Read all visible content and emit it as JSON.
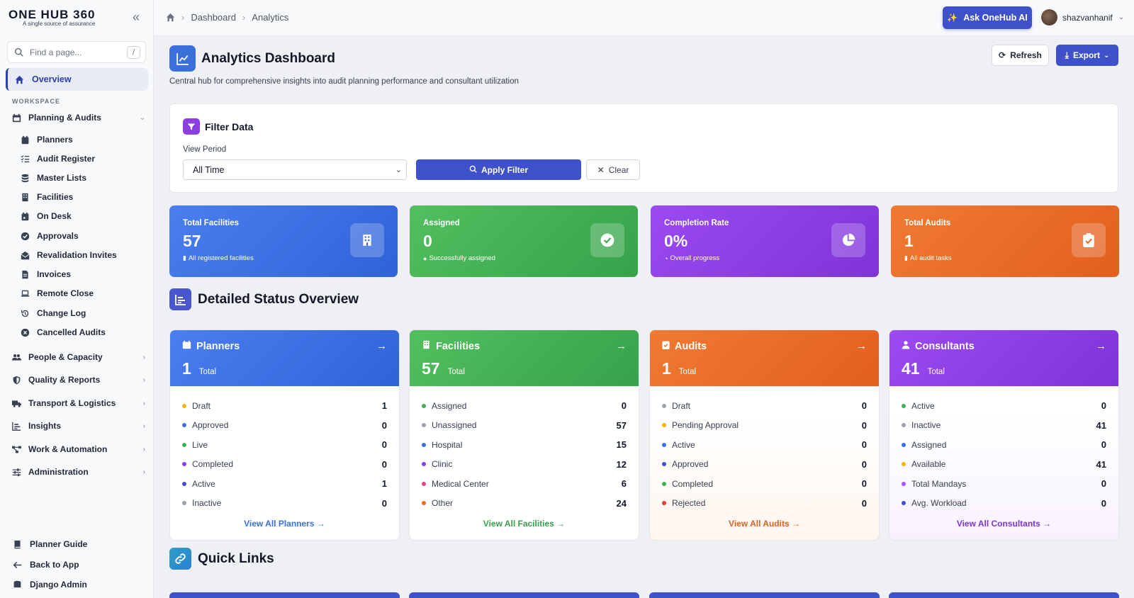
{
  "brand": {
    "name": "ONE HUB 360",
    "tagline": "A single source of assurance"
  },
  "sidebar": {
    "search_placeholder": "Find a page...",
    "search_shortcut": "/",
    "overview": "Overview",
    "workspace_label": "WORKSPACE",
    "planning_group": "Planning & Audits",
    "planning_items": [
      "Planners",
      "Audit Register",
      "Master Lists",
      "Facilities",
      "On Desk",
      "Approvals",
      "Revalidation Invites",
      "Invoices",
      "Remote Close",
      "Change Log",
      "Cancelled Audits"
    ],
    "groups": [
      "People & Capacity",
      "Quality & Reports",
      "Transport & Logistics",
      "Insights",
      "Work & Automation",
      "Administration"
    ],
    "footer": [
      "Planner Guide",
      "Back to App",
      "Django Admin"
    ]
  },
  "topbar": {
    "breadcrumbs": [
      "Dashboard",
      "Analytics"
    ],
    "ai_button": "Ask OneHub AI",
    "username": "shazvanhanif"
  },
  "page": {
    "title": "Analytics Dashboard",
    "subtitle": "Central hub for comprehensive insights into audit planning performance and consultant utilization",
    "refresh": "Refresh",
    "export": "Export"
  },
  "filter": {
    "title": "Filter Data",
    "period_label": "View Period",
    "period_value": "All Time",
    "apply": "Apply Filter",
    "clear": "Clear"
  },
  "stats": [
    {
      "label": "Total Facilities",
      "value": "57",
      "note": "All registered facilities",
      "color": "#3b6fe0"
    },
    {
      "label": "Assigned",
      "value": "0",
      "note": "Successfully assigned",
      "color": "#3fae54"
    },
    {
      "label": "Completion Rate",
      "value": "0%",
      "note": "Overall progress",
      "color": "#8c3ee6"
    },
    {
      "label": "Total Audits",
      "value": "1",
      "note": "All audit tasks",
      "color": "#ea6a26"
    }
  ],
  "status_section": "Detailed Status Overview",
  "cards": [
    {
      "title": "Planners",
      "total": "1",
      "total_word": "Total",
      "link": "View All Planners →",
      "color": "#3b6fe0",
      "rows": [
        {
          "label": "Draft",
          "value": "1",
          "dot": "#f5b400"
        },
        {
          "label": "Approved",
          "value": "0",
          "dot": "#3b6fe0"
        },
        {
          "label": "Live",
          "value": "0",
          "dot": "#3fae54"
        },
        {
          "label": "Completed",
          "value": "0",
          "dot": "#8c3ee6"
        },
        {
          "label": "Active",
          "value": "1",
          "dot": "#3f51c9"
        },
        {
          "label": "Inactive",
          "value": "0",
          "dot": "#9ca3af"
        }
      ]
    },
    {
      "title": "Facilities",
      "total": "57",
      "total_word": "Total",
      "link": "View All Facilities →",
      "color": "#3fae54",
      "rows": [
        {
          "label": "Assigned",
          "value": "0",
          "dot": "#3fae54"
        },
        {
          "label": "Unassigned",
          "value": "57",
          "dot": "#9ca3af"
        },
        {
          "label": "Hospital",
          "value": "15",
          "dot": "#3b6fe0"
        },
        {
          "label": "Clinic",
          "value": "12",
          "dot": "#8c3ee6"
        },
        {
          "label": "Medical Center",
          "value": "6",
          "dot": "#e0488a"
        },
        {
          "label": "Other",
          "value": "24",
          "dot": "#ea6a26"
        }
      ]
    },
    {
      "title": "Audits",
      "total": "1",
      "total_word": "Total",
      "link": "View All Audits →",
      "color": "#ea6a26",
      "rows": [
        {
          "label": "Draft",
          "value": "0",
          "dot": "#9ca3af"
        },
        {
          "label": "Pending Approval",
          "value": "0",
          "dot": "#f5b400"
        },
        {
          "label": "Active",
          "value": "0",
          "dot": "#3b6fe0"
        },
        {
          "label": "Approved",
          "value": "0",
          "dot": "#3f51c9"
        },
        {
          "label": "Completed",
          "value": "0",
          "dot": "#3fae54"
        },
        {
          "label": "Rejected",
          "value": "0",
          "dot": "#e53935"
        }
      ]
    },
    {
      "title": "Consultants",
      "total": "41",
      "total_word": "Total",
      "link": "View All Consultants →",
      "color": "#8c3ee6",
      "rows": [
        {
          "label": "Active",
          "value": "0",
          "dot": "#3fae54"
        },
        {
          "label": "Inactive",
          "value": "41",
          "dot": "#9ca3af"
        },
        {
          "label": "Assigned",
          "value": "0",
          "dot": "#3b6fe0"
        },
        {
          "label": "Available",
          "value": "41",
          "dot": "#f5b400"
        },
        {
          "label": "Total Mandays",
          "value": "0",
          "dot": "#a855f7"
        },
        {
          "label": "Avg. Workload",
          "value": "0",
          "dot": "#3f51c9"
        }
      ]
    }
  ],
  "quick_links_title": "Quick Links"
}
